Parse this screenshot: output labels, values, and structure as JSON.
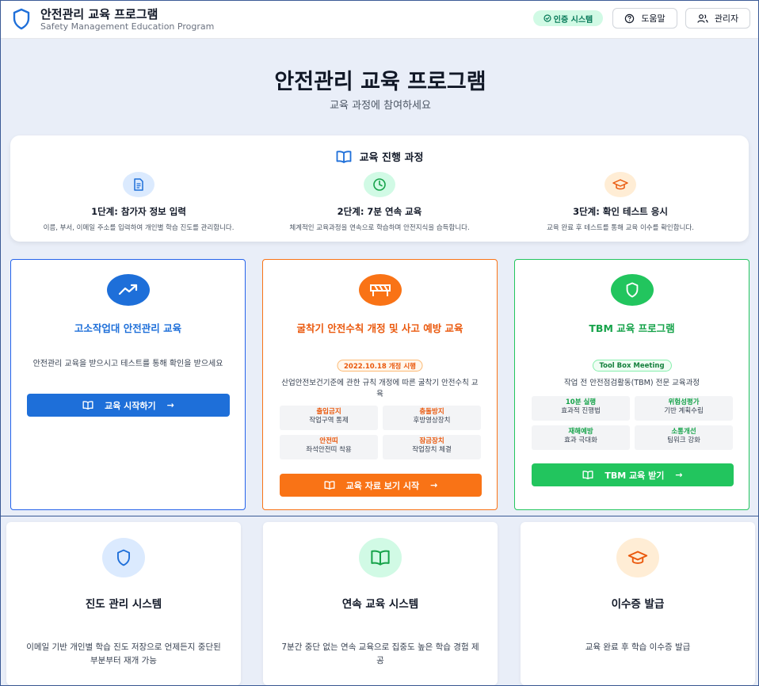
{
  "header": {
    "title": "안전관리 교육 프로그램",
    "subtitle": "Safety Management Education Program",
    "badge": "인증 시스템",
    "help_label": "도움말",
    "admin_label": "관리자"
  },
  "hero": {
    "title": "안전관리 교육 프로그램",
    "subtitle": "교육 과정에 참여하세요"
  },
  "process": {
    "title": "교육 진행 과정",
    "steps": [
      {
        "title": "1단계: 참가자 정보 입력",
        "desc": "이름, 부서, 이메일 주소를 입력하여 개인별 학습 진도를 관리합니다.",
        "icon": "document-icon"
      },
      {
        "title": "2단계: 7분 연속 교육",
        "desc": "체계적인 교육과정을 연속으로 학습하며 안전지식을 습득합니다.",
        "icon": "clock-icon"
      },
      {
        "title": "3단계: 확인 테스트 응시",
        "desc": "교육 완료 후 테스트를 통해 교육 이수를 확인합니다.",
        "icon": "graduation-cap-icon"
      }
    ]
  },
  "courses": [
    {
      "title": "고소작업대 안전관리 교육",
      "desc": "안전관리 교육을 받으시고 테스트를 통해 확인을 받으세요",
      "button": "교육 시작하기",
      "color": "#1e6fd9"
    },
    {
      "title": "굴착기 안전수칙 개정 및 사고 예방 교육",
      "pill": "2022.10.18 개정 시행",
      "desc": "산업안전보건기준에 관한 규칙 개정에 따른 굴착기 안전수칙 교육",
      "cells": [
        {
          "k": "출입금지",
          "v": "작업구역 통제"
        },
        {
          "k": "충돌방지",
          "v": "후방영상장치"
        },
        {
          "k": "안전띠",
          "v": "좌석안전띠 착용"
        },
        {
          "k": "잠금장치",
          "v": "작업장치 체결"
        }
      ],
      "button": "교육 자료 보기 시작",
      "color": "#f97316"
    },
    {
      "title": "TBM 교육 프로그램",
      "pill": "Tool Box Meeting",
      "desc": "작업 전 안전점검활동(TBM) 전문 교육과정",
      "cells": [
        {
          "k": "10분 실행",
          "v": "효과적 진행법"
        },
        {
          "k": "위험성평가",
          "v": "기반 계획수립"
        },
        {
          "k": "재해예방",
          "v": "효과 극대화"
        },
        {
          "k": "소통개선",
          "v": "팀워크 강화"
        }
      ],
      "button": "TBM 교육 받기",
      "color": "#22c55e"
    }
  ],
  "features": [
    {
      "title": "진도 관리 시스템",
      "desc": "이메일 기반 개인별 학습 진도 저장으로 언제든지 중단된 부분부터 재개 가능",
      "icon": "shield-icon"
    },
    {
      "title": "연속 교육 시스템",
      "desc": "7분간 중단 없는 연속 교육으로 집중도 높은 학습 경험 제공",
      "icon": "book-icon"
    },
    {
      "title": "이수증 발급",
      "desc": "교육 완료 후 학습 이수증 발급",
      "icon": "graduation-cap-icon"
    }
  ]
}
